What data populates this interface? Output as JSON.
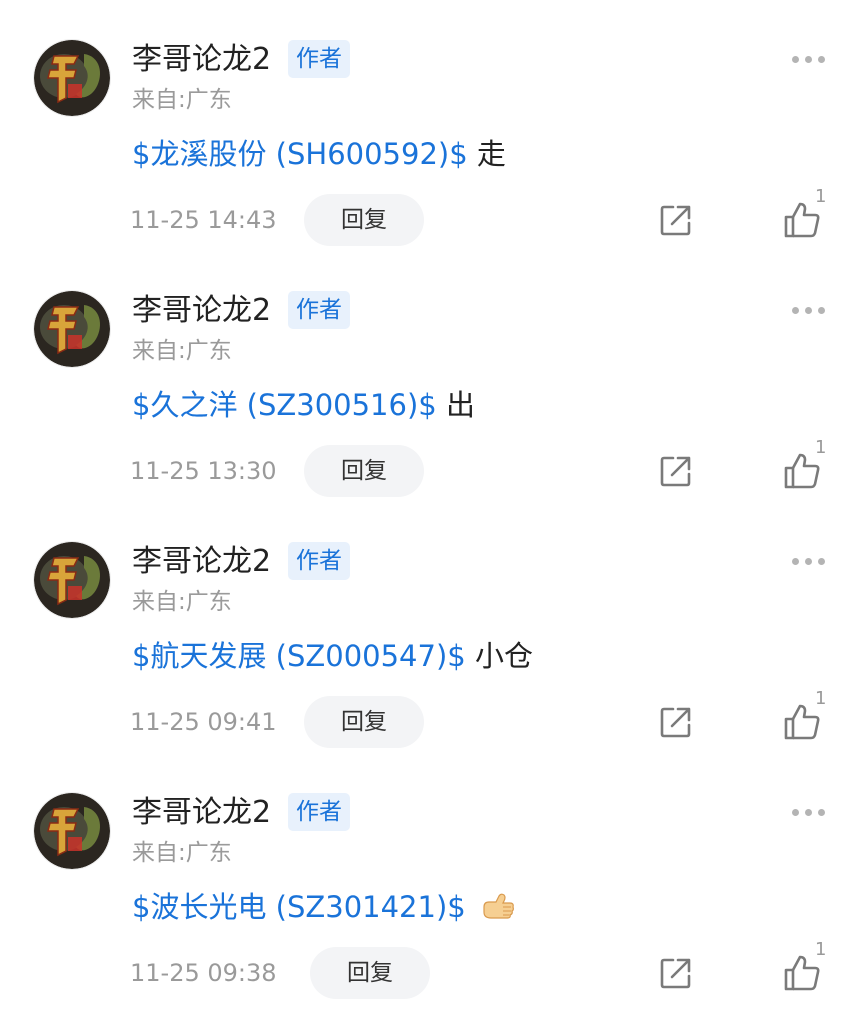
{
  "colors": {
    "link": "#1a73d9",
    "badge_bg": "#e8f1fc",
    "text": "#222222",
    "muted": "#9a9a9a",
    "reply_bg": "#f3f4f6"
  },
  "icons": {
    "more": "more-dots-icon",
    "share": "share-icon",
    "like": "thumbs-up-icon",
    "avatar": "dragon-logo-avatar",
    "emoji": "thumbs-up-emoji"
  },
  "comments": [
    {
      "author": "李哥论龙2",
      "badge": "作者",
      "location": "来自:广东",
      "stock": "$龙溪股份 (SH600592)$",
      "text": "走",
      "time": "11-25 14:43",
      "reply_label": "回复",
      "likes": "1"
    },
    {
      "author": "李哥论龙2",
      "badge": "作者",
      "location": "来自:广东",
      "stock": "$久之洋 (SZ300516)$",
      "text": "出",
      "time": "11-25 13:30",
      "reply_label": "回复",
      "likes": "1"
    },
    {
      "author": "李哥论龙2",
      "badge": "作者",
      "location": "来自:广东",
      "stock": "$航天发展 (SZ000547)$",
      "text": "小仓",
      "time": "11-25 09:41",
      "reply_label": "回复",
      "likes": "1"
    },
    {
      "author": "李哥论龙2",
      "badge": "作者",
      "location": "来自:广东",
      "stock": "$波长光电 (SZ301421)$",
      "text": "",
      "time": "11-25 09:38",
      "reply_label": "回复",
      "likes": "1"
    }
  ]
}
